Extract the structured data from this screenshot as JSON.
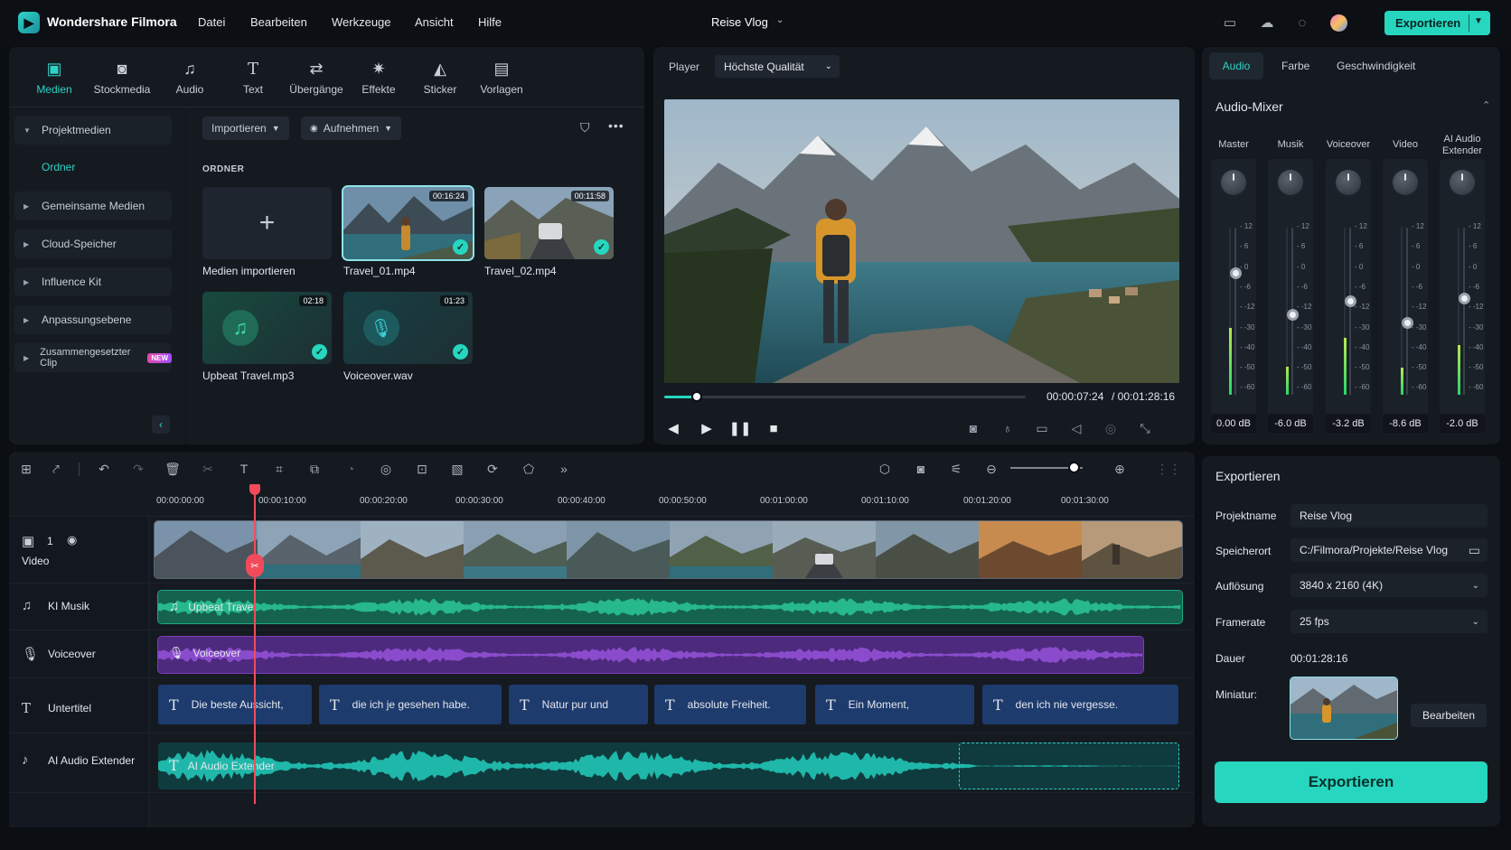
{
  "app": {
    "name": "Wondershare Filmora",
    "project_title": "Reise Vlog",
    "export_label": "Exportieren"
  },
  "menu": [
    "Datei",
    "Bearbeiten",
    "Werkzeuge",
    "Ansicht",
    "Hilfe"
  ],
  "toolbar": [
    {
      "label": "Medien",
      "icon": "media-icon",
      "active": true
    },
    {
      "label": "Stockmedia",
      "icon": "stock-media-icon"
    },
    {
      "label": "Audio",
      "icon": "music-note-icon"
    },
    {
      "label": "Text",
      "icon": "text-icon"
    },
    {
      "label": "Übergänge",
      "icon": "transition-icon"
    },
    {
      "label": "Effekte",
      "icon": "effects-icon"
    },
    {
      "label": "Sticker",
      "icon": "sticker-icon"
    },
    {
      "label": "Vorlagen",
      "icon": "templates-icon"
    }
  ],
  "sidebar": {
    "items": [
      "Projektmedien",
      "Gemeinsame Medien",
      "Cloud-Speicher",
      "Influence Kit",
      "Anpassungsebene",
      "Zusammengesetzter Clip"
    ],
    "sub_item": "Ordner",
    "new_badge": "NEW"
  },
  "library": {
    "import_label": "Importieren",
    "record_label": "Aufnehmen",
    "section_label": "ORDNER",
    "import_media_label": "Medien importieren",
    "items": [
      {
        "name": "Travel_01.mp4",
        "duration": "00:16:24"
      },
      {
        "name": "Travel_02.mp4",
        "duration": "00:11:58"
      },
      {
        "name": "Upbeat Travel.mp3",
        "duration": "02:18"
      },
      {
        "name": "Voiceover.wav",
        "duration": "01:23"
      }
    ]
  },
  "player": {
    "tab": "Player",
    "quality": "Höchste Qualität",
    "current_time": "00:00:07:24",
    "total_time": "/ 00:01:28:16",
    "progress": 0.09
  },
  "right_tabs": [
    "Audio",
    "Farbe",
    "Geschwindigkeit"
  ],
  "mixer": {
    "title": "Audio-Mixer",
    "scale": [
      "12",
      "6",
      "0",
      "-6",
      "-12",
      "-30",
      "-40",
      "-50",
      "-60"
    ],
    "channels": [
      {
        "name": "Master",
        "db": "0.00 dB",
        "fader": 0.0,
        "meter": 0.4
      },
      {
        "name": "Musik",
        "db": "-6.0 dB",
        "fader": 0.5,
        "meter": 0.17
      },
      {
        "name": "Voiceover",
        "db": "-3.2 dB",
        "fader": 0.33,
        "meter": 0.34
      },
      {
        "name": "Video",
        "db": "-8.6 dB",
        "fader": 0.59,
        "meter": 0.16
      },
      {
        "name": "AI Audio Extender",
        "db": "-2.0 dB",
        "fader": 0.3,
        "meter": 0.3
      }
    ]
  },
  "export_panel": {
    "title": "Exportieren",
    "project_name_label": "Projektname",
    "project_name": "Reise Vlog",
    "location_label": "Speicherort",
    "location": "C:/Filmora/Projekte/Reise Vlog",
    "resolution_label": "Auflösung",
    "resolution": "3840 x 2160 (4K)",
    "framerate_label": "Framerate",
    "framerate": "25 fps",
    "duration_label": "Dauer",
    "duration": "00:01:28:16",
    "thumbnail_label": "Miniatur:",
    "edit_label": "Bearbeiten",
    "export_label": "Exportieren"
  },
  "timeline": {
    "ruler": [
      "00:00:00:00",
      "00:00:10:00",
      "00:00:20:00",
      "00:00:30:00",
      "00:00:40:00",
      "00:00:50:00",
      "00:01:00:00",
      "00:01:10:00",
      "00:01:20:00",
      "00:01:30:00"
    ],
    "tracks": [
      {
        "name": "Video",
        "index": "1"
      },
      {
        "name": "KI Musik"
      },
      {
        "name": "Voiceover"
      },
      {
        "name": "Untertitel"
      },
      {
        "name": "AI Audio Extender"
      }
    ],
    "music_clip": "Upbeat Travel",
    "voice_clip": "Voiceover",
    "extender_clip": "AI Audio Extender",
    "subtitles": [
      "Die beste Aussicht,",
      "die ich je gesehen habe.",
      "Natur pur und",
      "absolute Freiheit.",
      "Ein Moment,",
      "den ich nie vergesse."
    ],
    "zoom": 0.88
  },
  "colors": {
    "accent": "#27d6bf",
    "music": "#1fa783",
    "voice": "#7b3fb8",
    "subtitle": "#1e3b6e",
    "playhead": "#f14b5b"
  }
}
